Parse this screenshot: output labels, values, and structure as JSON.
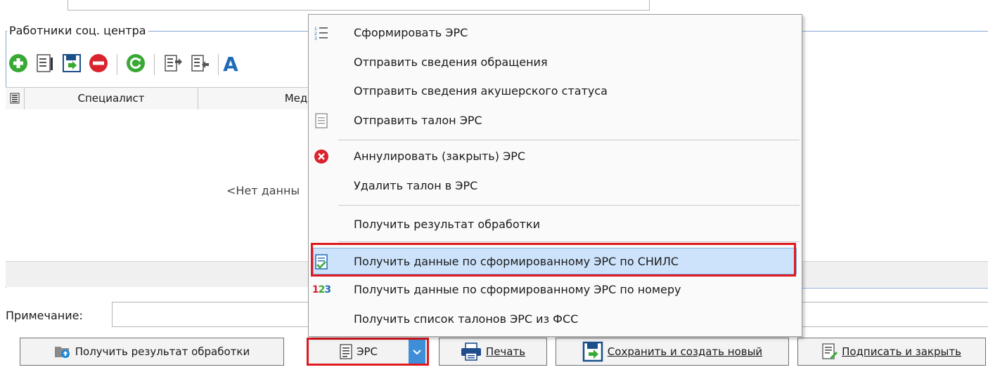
{
  "group": {
    "title": "Работники соц. центра"
  },
  "toolbar": {
    "icons": [
      "add-icon",
      "edit-icon",
      "save-icon",
      "delete-icon",
      "refresh-icon",
      "move-right-icon",
      "move-left-icon"
    ]
  },
  "grid": {
    "columns": [
      "Специалист",
      "Мед."
    ],
    "empty_text": "<Нет данны"
  },
  "note": {
    "label": "Примечание:",
    "value": ""
  },
  "buttons": {
    "get_result": "Получить результат обработки",
    "ers": "ЭРС",
    "print": "Печать",
    "save_new": "Сохранить и создать новый",
    "sign_close": "Подписать и закрыть"
  },
  "menu": {
    "items": [
      {
        "label": "Сформировать ЭРС",
        "icon": "list-numbered-icon"
      },
      {
        "label": "Отправить сведения обращения",
        "icon": ""
      },
      {
        "label": "Отправить сведения акушерского статуса",
        "icon": ""
      },
      {
        "label": "Отправить талон ЭРС",
        "icon": "document-icon"
      },
      {
        "label": "Аннулировать (закрыть) ЭРС",
        "icon": "cancel-icon"
      },
      {
        "label": "Удалить талон в ЭРС",
        "icon": ""
      },
      {
        "label": "Получить результат обработки",
        "icon": ""
      },
      {
        "label": "Получить данные по сформированному ЭРС по СНИЛС",
        "icon": "document-check-icon",
        "highlighted": true
      },
      {
        "label": "Получить данные по сформированному ЭРС по номеру",
        "icon": "numbers-123-icon"
      },
      {
        "label": "Получить список талонов ЭРС из ФСС",
        "icon": ""
      }
    ],
    "highlight_border_color": "#e0191f",
    "highlight_bg": "#cde3fb"
  },
  "colors": {
    "accent": "#1e88d8",
    "green": "#39a935",
    "red": "#d9232d",
    "frame": "#8aa9d6"
  }
}
